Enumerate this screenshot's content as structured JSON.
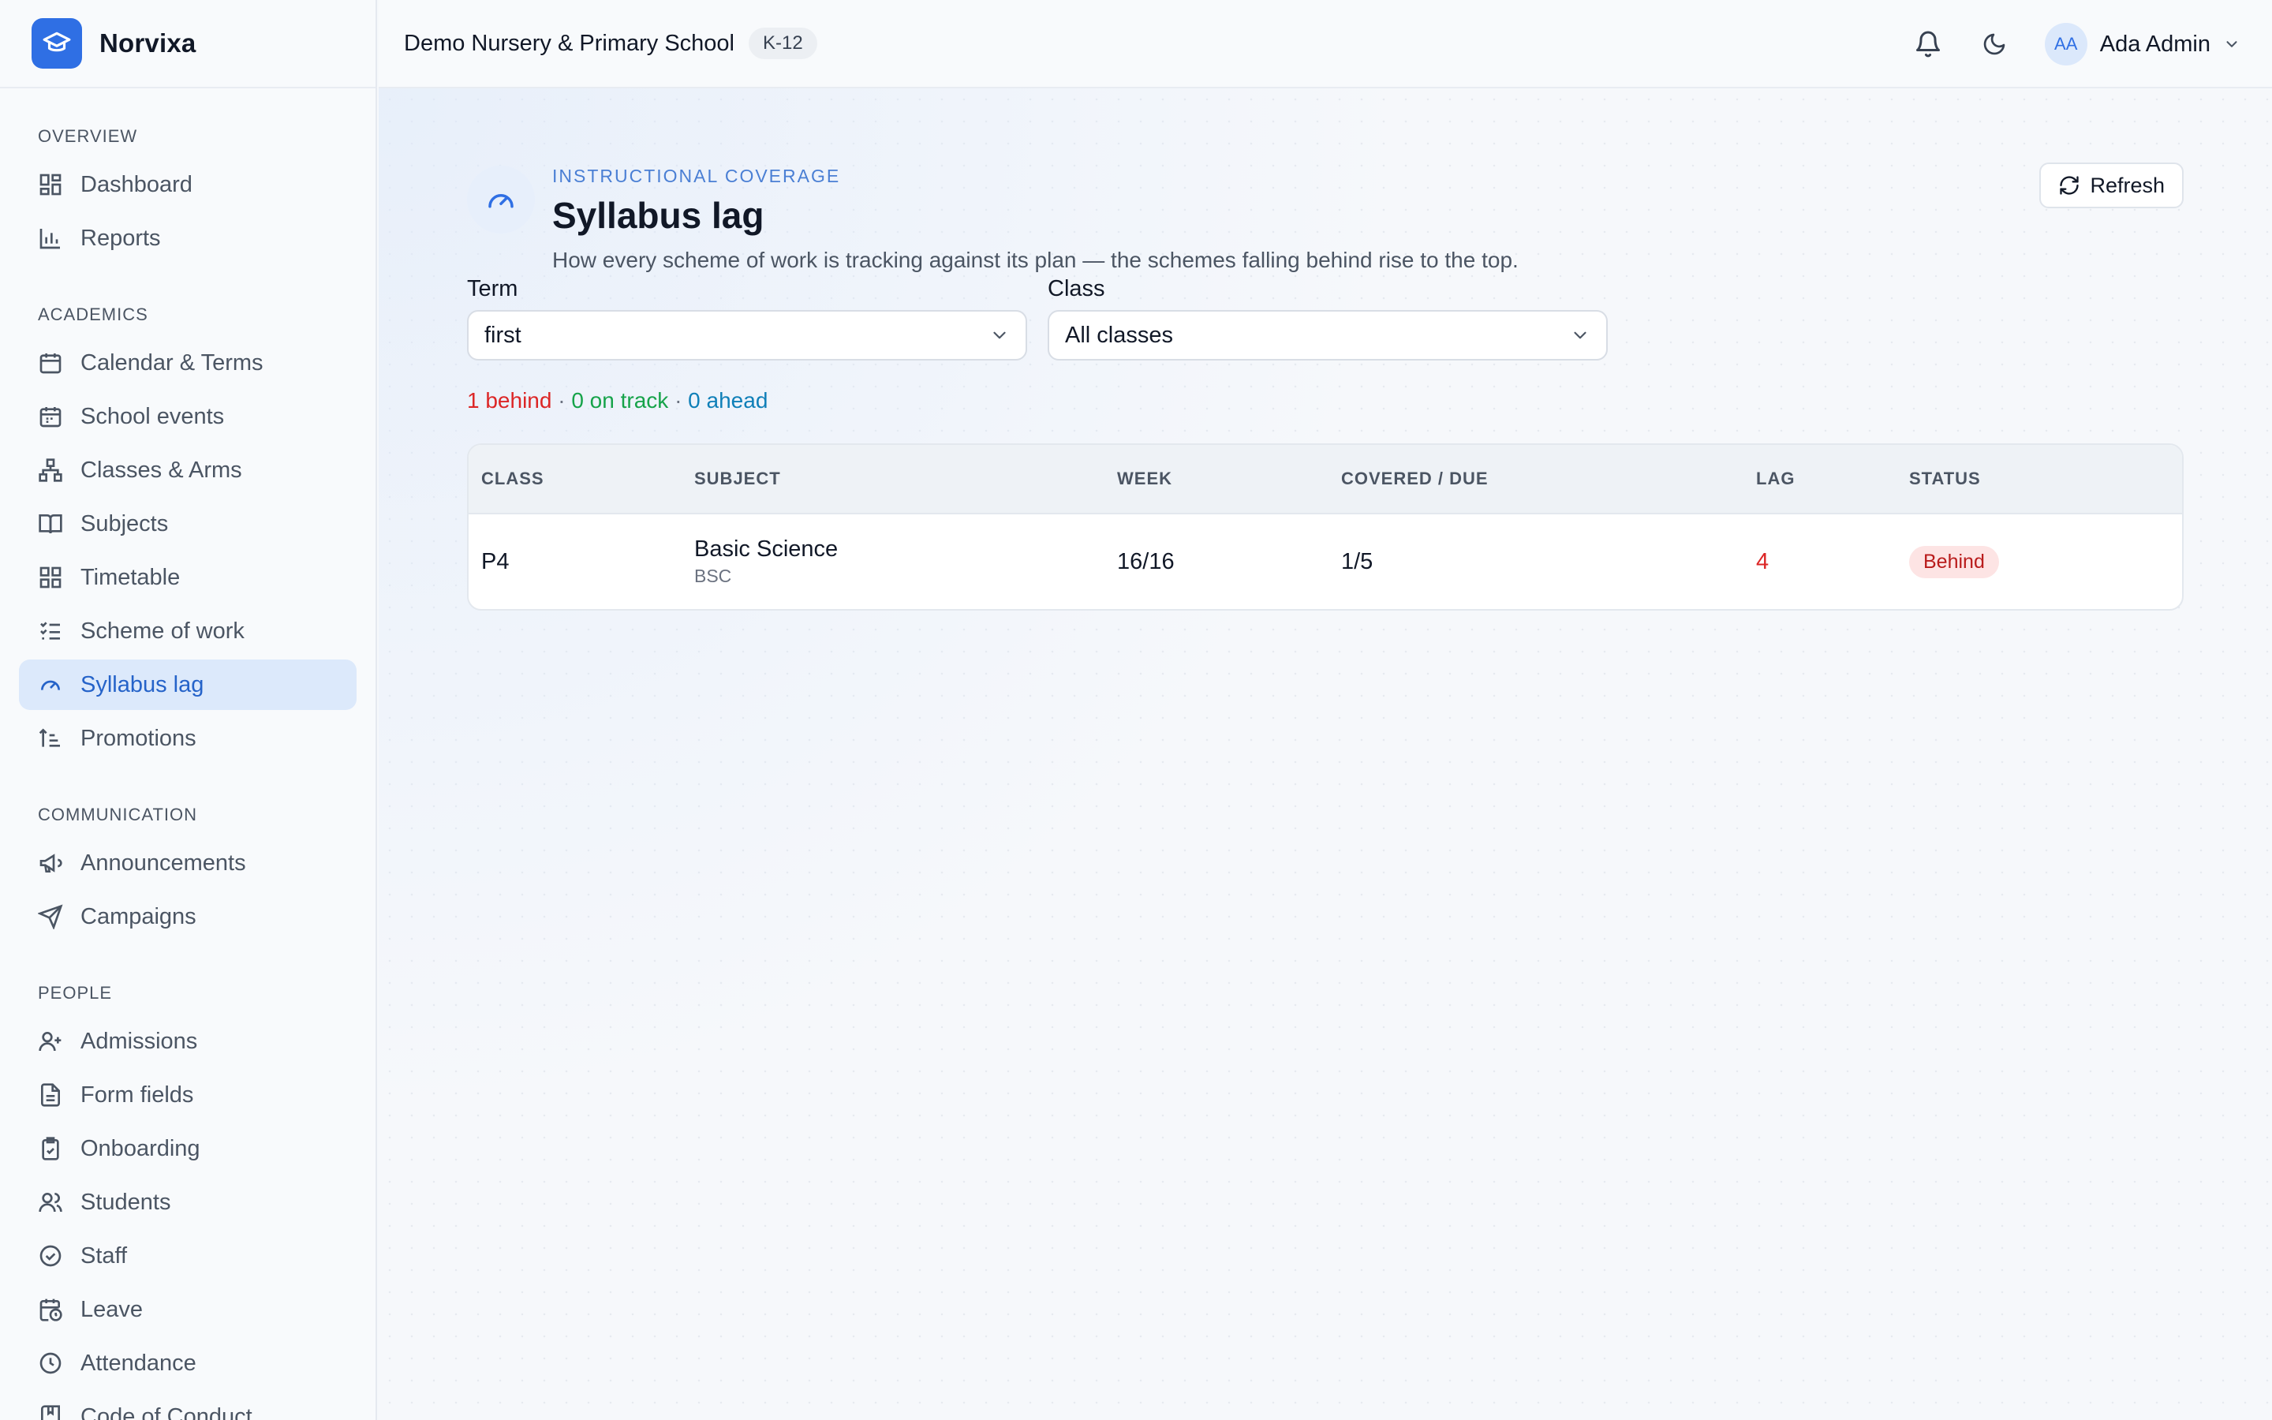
{
  "app": {
    "name": "Norvixa"
  },
  "header": {
    "school_name": "Demo Nursery & Primary School",
    "grade_badge": "K-12",
    "user": {
      "initials": "AA",
      "name": "Ada Admin"
    }
  },
  "sidebar": {
    "sections": [
      {
        "heading": "Overview",
        "items": [
          {
            "label": "Dashboard",
            "icon": "dashboard-icon"
          },
          {
            "label": "Reports",
            "icon": "bar-chart-icon"
          }
        ]
      },
      {
        "heading": "Academics",
        "items": [
          {
            "label": "Calendar & Terms",
            "icon": "calendar-icon"
          },
          {
            "label": "School events",
            "icon": "calendar-icon"
          },
          {
            "label": "Classes & Arms",
            "icon": "hierarchy-icon"
          },
          {
            "label": "Subjects",
            "icon": "book-icon"
          },
          {
            "label": "Timetable",
            "icon": "grid-icon"
          },
          {
            "label": "Scheme of work",
            "icon": "checklist-icon"
          },
          {
            "label": "Syllabus lag",
            "icon": "gauge-icon",
            "active": true
          },
          {
            "label": "Promotions",
            "icon": "sort-up-icon"
          }
        ]
      },
      {
        "heading": "Communication",
        "items": [
          {
            "label": "Announcements",
            "icon": "megaphone-icon"
          },
          {
            "label": "Campaigns",
            "icon": "send-icon"
          }
        ]
      },
      {
        "heading": "People",
        "items": [
          {
            "label": "Admissions",
            "icon": "user-plus-icon"
          },
          {
            "label": "Form fields",
            "icon": "document-icon"
          },
          {
            "label": "Onboarding",
            "icon": "clipboard-check-icon"
          },
          {
            "label": "Students",
            "icon": "users-icon"
          },
          {
            "label": "Staff",
            "icon": "badge-check-icon"
          },
          {
            "label": "Leave",
            "icon": "calendar-clock-icon"
          },
          {
            "label": "Attendance",
            "icon": "clock-icon"
          },
          {
            "label": "Code of Conduct",
            "icon": "book-bookmark-icon"
          }
        ]
      }
    ]
  },
  "page": {
    "eyebrow": "Instructional coverage",
    "title": "Syllabus lag",
    "subtitle": "How every scheme of work is tracking against its plan — the schemes falling behind rise to the top.",
    "refresh_label": "Refresh"
  },
  "filters": {
    "term": {
      "label": "Term",
      "value": "first"
    },
    "class": {
      "label": "Class",
      "value": "All classes"
    }
  },
  "summary": {
    "behind": "1 behind",
    "on_track": "0 on track",
    "ahead": "0 ahead",
    "separator": "·"
  },
  "table": {
    "columns": [
      "Class",
      "Subject",
      "Week",
      "Covered / Due",
      "Lag",
      "Status"
    ],
    "rows": [
      {
        "class": "P4",
        "subject": "Basic Science",
        "subject_code": "BSC",
        "week": "16/16",
        "covered_due": "1/5",
        "lag": "4",
        "status": "Behind"
      }
    ]
  },
  "colors": {
    "accent": "#2f6fe4",
    "behind": "#dc2626",
    "on_track": "#16a34a",
    "ahead": "#0f7fb8"
  }
}
